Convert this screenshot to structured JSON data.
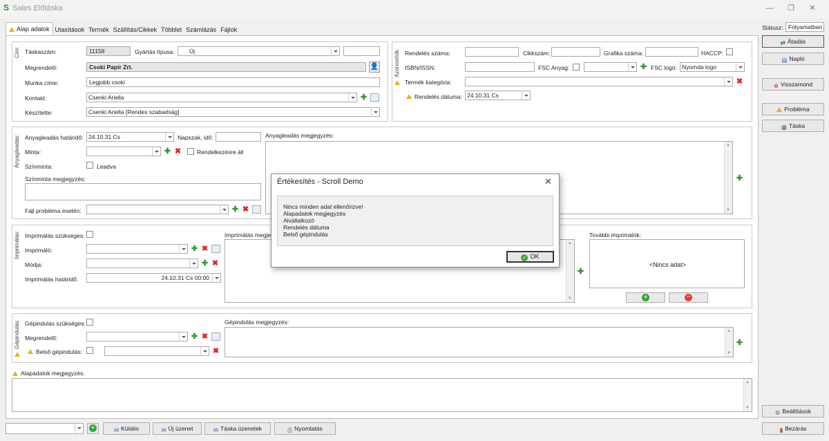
{
  "window": {
    "title": "Sales Előtáska",
    "app_icon": "S"
  },
  "tabs": [
    "Alap adatok",
    "Utasítások",
    "Termék",
    "Szállítás/Cikkek",
    "Többlet",
    "Számlázás",
    "Fájlok"
  ],
  "status": {
    "label": "Státusz:",
    "value": "Folyamatban"
  },
  "cim": {
    "group_label": "Cím:",
    "taskaszam_label": "Táskaszám:",
    "taskaszam_value": "11158",
    "gyartas_label": "Gyártás típusa:",
    "gyartas_value": "Új",
    "megrendelo_label": "Megrendelő:",
    "megrendelo_value": "Csoki Papír Zrt.",
    "munka_label": "Munka címe:",
    "munka_value": "Legjobb csoki",
    "kontakt_label": "Kontakt:",
    "kontakt_value": "Csenki Ariella",
    "keszitette_label": "Készítette:",
    "keszitette_value": "Csenki Ariella [Rendes szabadság]"
  },
  "azon": {
    "group_label": "Azonosítók:",
    "rendeles_szama_label": "Rendelés száma:",
    "cikkszam_label": "Cikkszám:",
    "grafika_label": "Grafika száma:",
    "haccp_label": "HACCP:",
    "isbn_label": "ISBN/ISSN:",
    "fsc_anyag_label": "FSC Anyag:",
    "fsc_logo_label": "FSC logó:",
    "fsc_logo_value": "Nyomda logo",
    "termek_kat_label": "Termék kategória:",
    "rendeles_datum_label": "Rendelés dátuma:",
    "rendeles_datum_value": "24.10.31 Cs"
  },
  "anyag": {
    "group_label": "Anyagleadás:",
    "hatarido_label": "Anyagleadás határidő:",
    "hatarido_value": "24.10.31 Cs",
    "napszak_label": "Napszak, idő:",
    "minta_label": "Minta:",
    "rendelkezes_label": "Rendelkezésre áll",
    "szinminta_label": "Színminta:",
    "leadva_label": "Leadva",
    "szinminta_megj_label": "Színminta megjegyzés:",
    "fajl_label": "Fájl probléma esetén:",
    "megj_label": "Anyagleadás megjegyzés:"
  },
  "impr": {
    "group_label": "Imprimálás:",
    "szukseges_label": "Imprimálás szükséges:",
    "imprimalo_label": "Imprimáló:",
    "modja_label": "Módja:",
    "hatarido_label": "Imprimálás határidő:",
    "hatarido_value": "24.10.31 Cs 00:00",
    "megj_label": "Imprimálás megjegyzés:",
    "tovabbi_label": "További imprimálók:",
    "nincs_adat": "<Nincs adat>"
  },
  "gep": {
    "group_label": "Gépindulás:",
    "szukseges_label": "Gépindulás szükséges:",
    "megrendelo_label": "Megrendelő:",
    "belso_label": "Belső gépindulás:",
    "megj_label": "Gépindulás megjegyzés:"
  },
  "alap_megj_label": "Alapadatok megjegyzés:",
  "right_buttons": {
    "atadas": "Átadás",
    "naplo": "Napló",
    "visszamond": "Visszamond",
    "problema": "Probléma",
    "taska": "Táska",
    "beallitasok": "Beállítások",
    "bezaras": "Bezárás"
  },
  "bottom_buttons": {
    "kuldes": "Küldés",
    "uj_uzenet": "Új üzenet",
    "taska_uzenetek": "Táska üzenetek",
    "nyomtatas": "Nyomtatás"
  },
  "dialog": {
    "title": "Értékesítés - Scroll Demo",
    "messages": [
      "Nincs minden adat ellenőrizve!",
      "Alapadatok megjegyzés",
      "Alvállalkozó",
      "Rendelés dátuma",
      "Belső gépindulás"
    ],
    "ok": "OK"
  },
  "colors": {
    "accent_green": "#2a9a2a",
    "danger_red": "#e02020",
    "warning": "#e8b020"
  }
}
